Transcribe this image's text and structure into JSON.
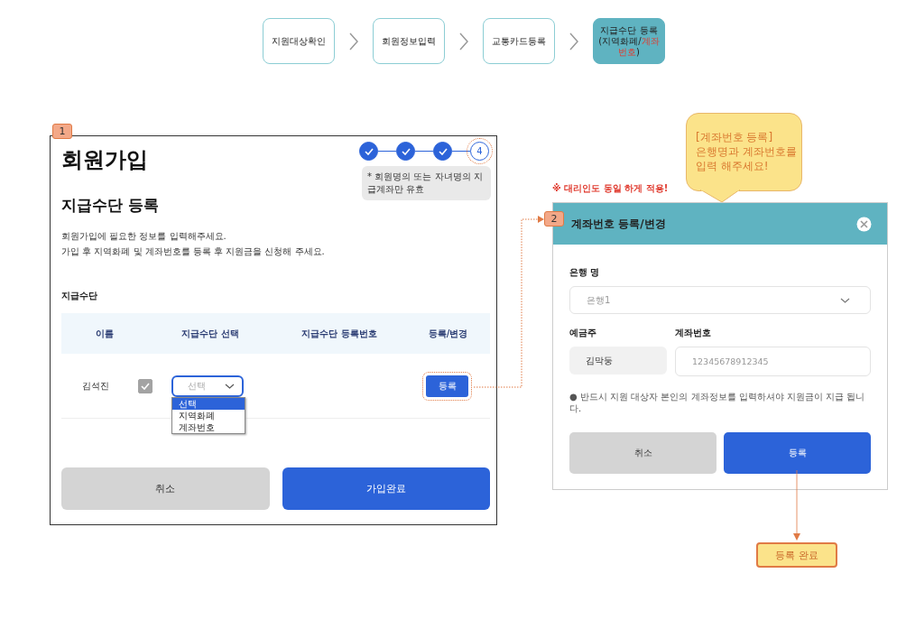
{
  "flow_steps": [
    {
      "label": "지원대상확인",
      "selected": false
    },
    {
      "label": "회원정보입력",
      "selected": false
    },
    {
      "label": "교통카드등록",
      "selected": false
    },
    {
      "label": "지급수단 등록 (지역화폐/**계좌 번호**)",
      "selected": true
    }
  ],
  "signup": {
    "badge": "1",
    "title": "회원가입",
    "progress": [
      {
        "done": true
      },
      {
        "done": true
      },
      {
        "done": true
      },
      {
        "done": false,
        "label": "4"
      }
    ],
    "note": "* 회원명의 또는 자녀명의 지급계좌만 유효",
    "subtitle": "지급수단 등록",
    "description": [
      "회원가입에 필요한 정보를 입력해주세요.",
      "가입 후 지역화폐 및 계좌번호를 등록 후 지원금을 신청해 주세요."
    ],
    "section": "지급수단",
    "table": {
      "columns": [
        "이름",
        "지급수단 선택",
        "지급수단 등록번호",
        "등록/변경"
      ],
      "rows": [
        {
          "name": "김석진",
          "checked": true,
          "select": "선택",
          "options": [
            {
              "label": "선택",
              "selected": true
            },
            {
              "label": "지역화폐",
              "selected": false
            },
            {
              "label": "계좌번호",
              "selected": false
            }
          ],
          "action": "등록"
        }
      ]
    },
    "buttons": {
      "cancel": "취소",
      "submit": "가입완료"
    }
  },
  "proxy_note": "※ 대리인도 동일 하게 적용!",
  "callout": [
    "[계좌번호 등록]",
    "은행명과 계좌번호를",
    "입력 해주세요!"
  ],
  "account_dialog": {
    "badge": "2",
    "title": "계좌번호 등록/변경",
    "bank_label": "은행 명",
    "bank_value": "은행1",
    "holder_label": "예금주",
    "holder_value": "김막둥",
    "account_label": "계좌번호",
    "account_placeholder": "12345678912345",
    "notice": "● 반드시 지원 대상자 본인의 계좌정보를 입력하셔야 지원금이 지급 됩니다.",
    "buttons": {
      "cancel": "취소",
      "submit": "등록"
    }
  },
  "result": "등록 완료"
}
